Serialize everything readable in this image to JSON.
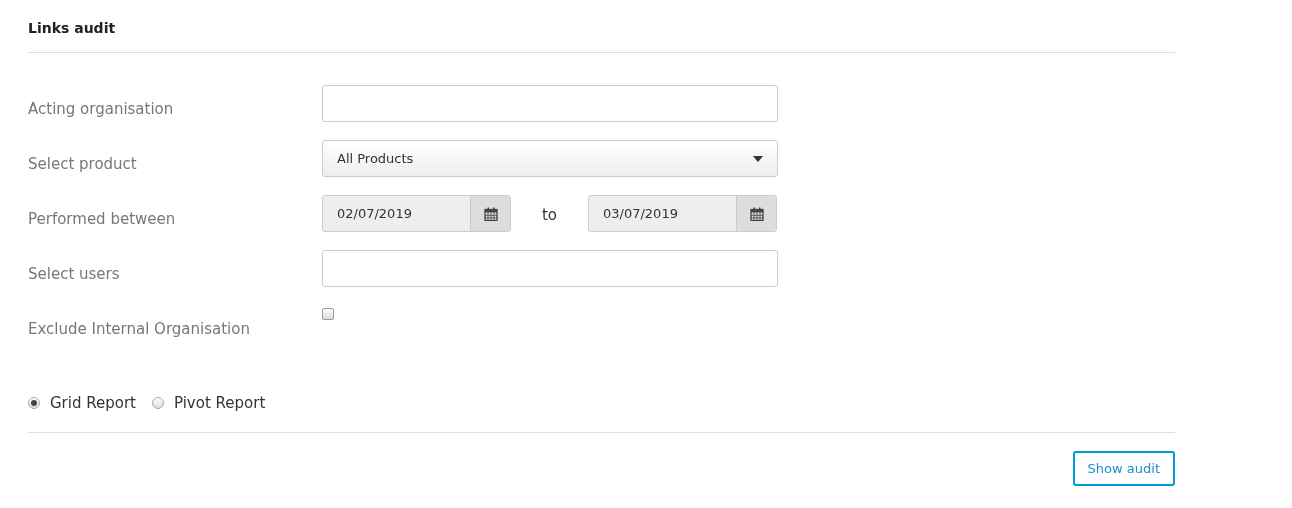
{
  "title": "Links audit",
  "fields": [
    {
      "kind": "text",
      "label": "Acting organisation"
    },
    {
      "kind": "select",
      "label": "Select product",
      "value": "All Products"
    },
    {
      "kind": "daterange",
      "label": "Performed between",
      "from": "02/07/2019",
      "separator": "to",
      "to": "03/07/2019"
    },
    {
      "kind": "text",
      "label": "Select users"
    },
    {
      "kind": "checkbox",
      "label": "Exclude Internal Organisation",
      "checked": false
    }
  ],
  "report_types": [
    {
      "label": "Grid Report",
      "selected": true
    },
    {
      "label": "Pivot Report",
      "selected": false
    }
  ],
  "button": "Show audit"
}
